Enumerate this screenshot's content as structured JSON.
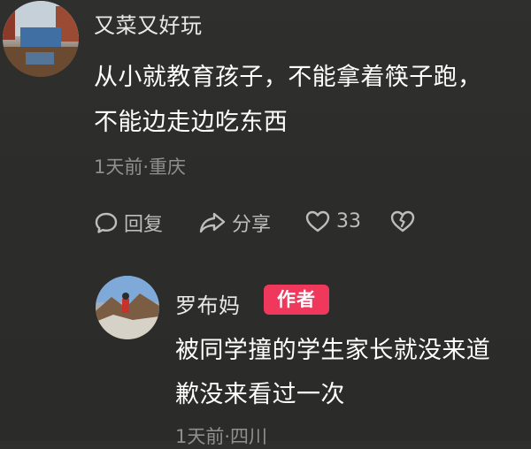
{
  "comment": {
    "username": "又菜又好玩",
    "text_line1": "从小就教育孩子，不能拿着筷子跑，",
    "text_line2": "不能边走边吃东西",
    "meta": "1天前·重庆",
    "actions": {
      "reply_label": "回复",
      "share_label": "分享",
      "like_count": "33"
    }
  },
  "reply": {
    "username": "罗布妈",
    "badge": "作者",
    "text_line1": "被同学撞的学生家长就没来道",
    "text_line2": "歉没来看过一次",
    "meta": "1天前·四川"
  },
  "colors": {
    "badge_bg": "#f0375c",
    "meta_text": "#8f8f8f",
    "action_text": "#bdbdbd"
  }
}
